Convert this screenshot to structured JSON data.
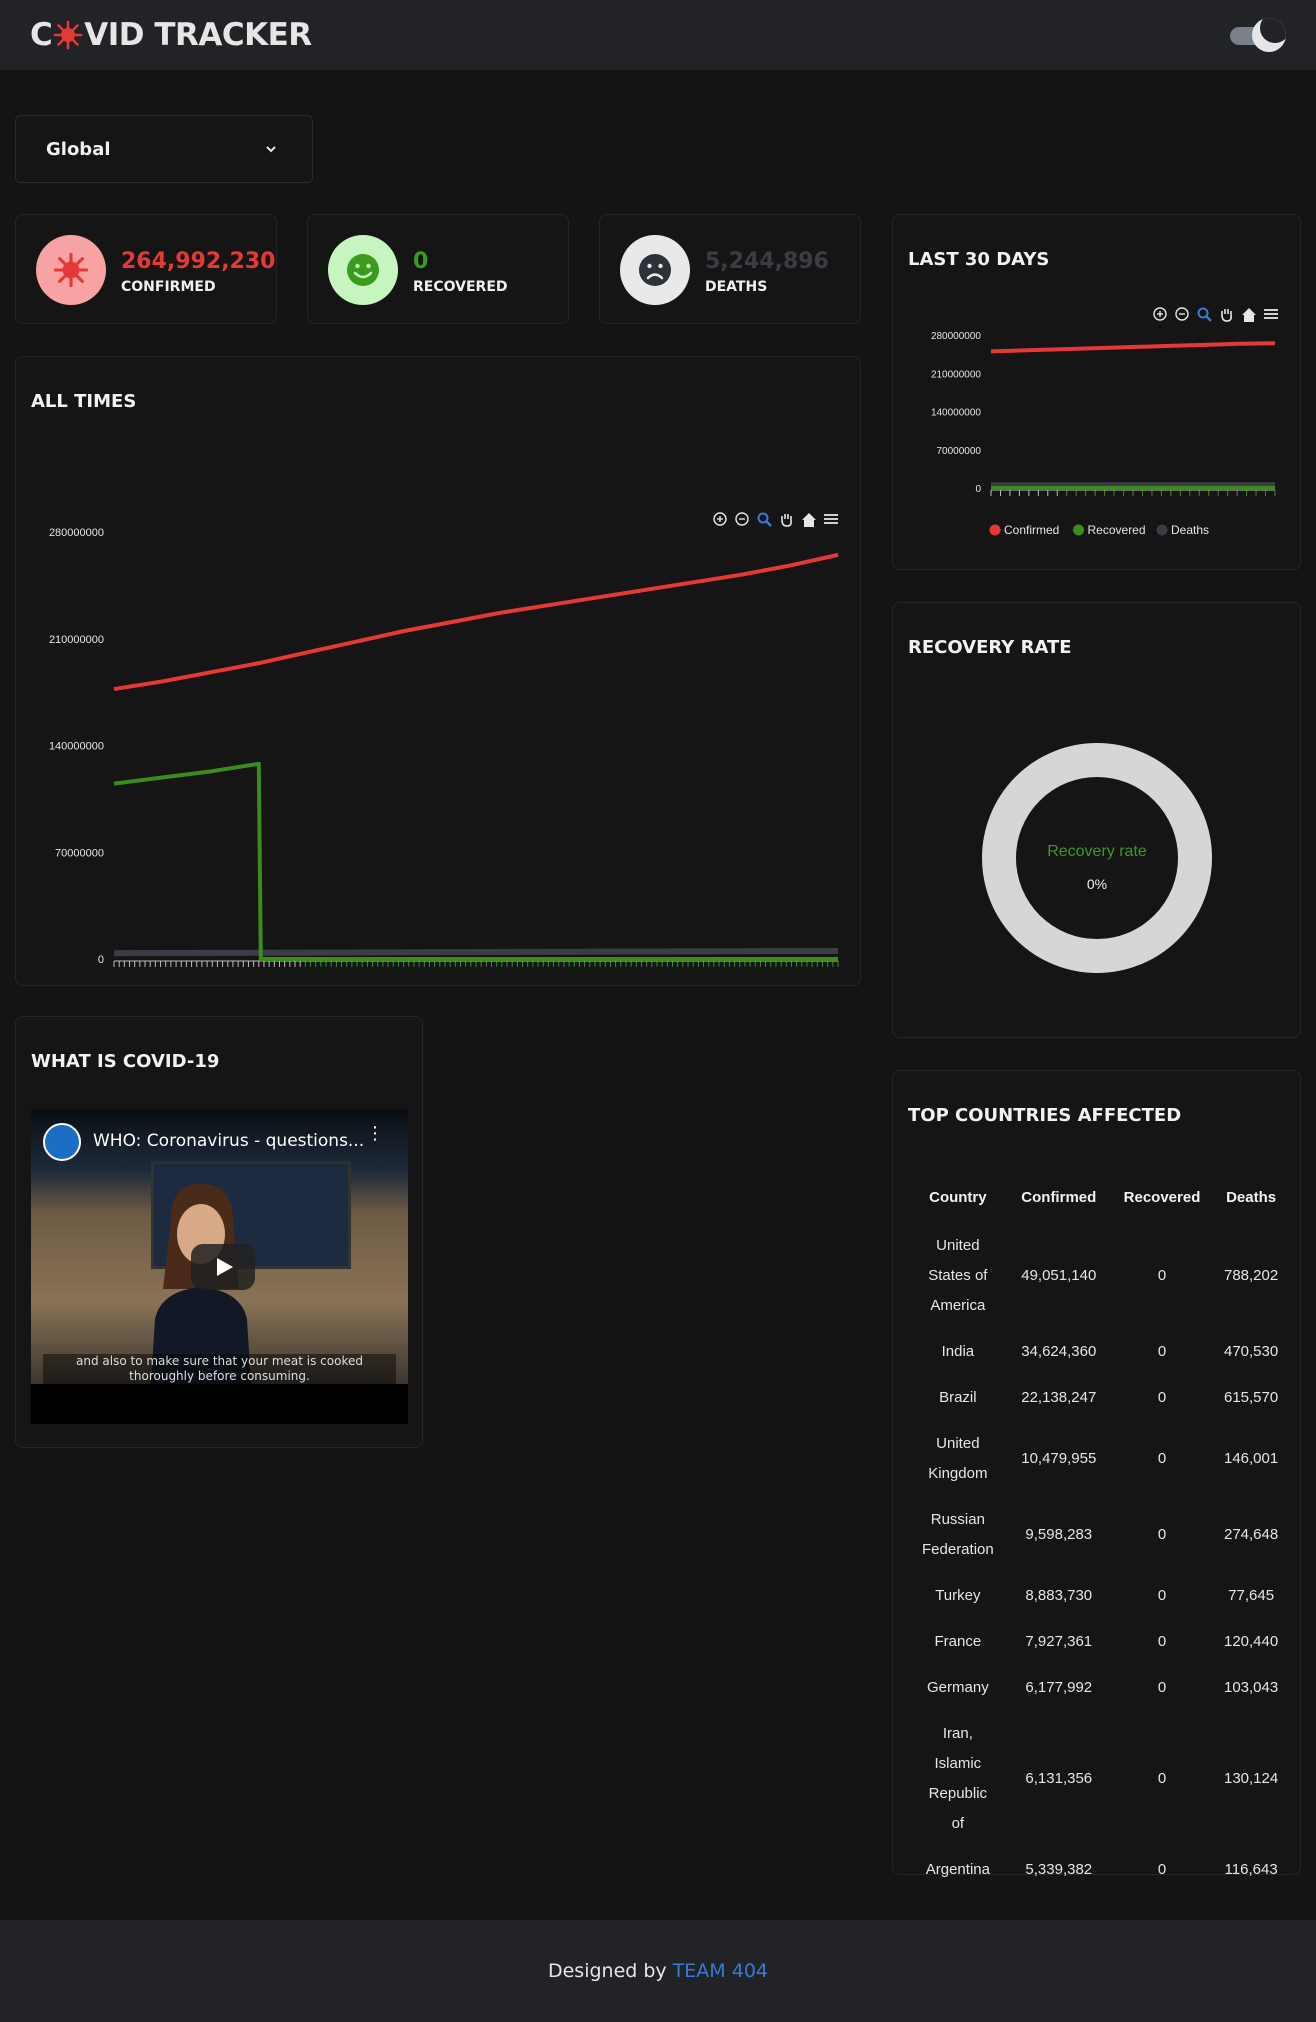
{
  "header": {
    "logo_prefix": "C",
    "logo_suffix": "VID TRACKER",
    "logo_icon": "virus-icon",
    "theme_toggle_icon": "moon-icon"
  },
  "region_select": {
    "value": "Global"
  },
  "stats": [
    {
      "value": "264,992,230",
      "label": "CONFIRMED",
      "color": "#e53935",
      "icon": "virus-icon"
    },
    {
      "value": "0",
      "label": "RECOVERED",
      "color": "#3c9a1c",
      "icon": "smile-icon"
    },
    {
      "value": "5,244,896",
      "label": "DEATHS",
      "color": "#3a3d44",
      "icon": "sad-icon"
    }
  ],
  "all_times": {
    "title": "ALL TIMES"
  },
  "last_30": {
    "title": "LAST 30 DAYS"
  },
  "recovery": {
    "title": "RECOVERY RATE",
    "label": "Recovery rate",
    "value": "0%"
  },
  "video": {
    "section_title": "WHAT IS COVID-19",
    "title": "WHO: Coronavirus - questions...",
    "caption_line1": "and also to make sure that your meat is cooked",
    "caption_line2": "thoroughly before consuming."
  },
  "top_countries": {
    "title": "TOP COUNTRIES AFFECTED",
    "columns": [
      "Country",
      "Confirmed",
      "Recovered",
      "Deaths"
    ],
    "rows": [
      {
        "country": "United States of America",
        "confirmed": "49,051,140",
        "recovered": "0",
        "deaths": "788,202"
      },
      {
        "country": "India",
        "confirmed": "34,624,360",
        "recovered": "0",
        "deaths": "470,530"
      },
      {
        "country": "Brazil",
        "confirmed": "22,138,247",
        "recovered": "0",
        "deaths": "615,570"
      },
      {
        "country": "United Kingdom",
        "confirmed": "10,479,955",
        "recovered": "0",
        "deaths": "146,001"
      },
      {
        "country": "Russian Federation",
        "confirmed": "9,598,283",
        "recovered": "0",
        "deaths": "274,648"
      },
      {
        "country": "Turkey",
        "confirmed": "8,883,730",
        "recovered": "0",
        "deaths": "77,645"
      },
      {
        "country": "France",
        "confirmed": "7,927,361",
        "recovered": "0",
        "deaths": "120,440"
      },
      {
        "country": "Germany",
        "confirmed": "6,177,992",
        "recovered": "0",
        "deaths": "103,043"
      },
      {
        "country": "Iran, Islamic Republic of",
        "confirmed": "6,131,356",
        "recovered": "0",
        "deaths": "130,124"
      },
      {
        "country": "Argentina",
        "confirmed": "5,339,382",
        "recovered": "0",
        "deaths": "116,643"
      }
    ]
  },
  "footer": {
    "prefix": "Designed by",
    "team": "TEAM 404"
  },
  "chart_toolbar_icons": [
    "zoom-in-icon",
    "zoom-out-icon",
    "zoom-icon",
    "pan-icon",
    "home-icon",
    "menu-icon"
  ],
  "chart_data": [
    {
      "type": "line",
      "ylim": [
        0,
        280000000
      ],
      "yticks": [
        "280000000",
        "210000000",
        "140000000",
        "70000000",
        "0"
      ],
      "legend": "bottom",
      "series": [
        {
          "name": "Confirmed",
          "color": "#e53935",
          "values": [
            177000000,
            182000000,
            188000000,
            194000000,
            201000000,
            208000000,
            215000000,
            221000000,
            227000000,
            232000000,
            237000000,
            242000000,
            247000000,
            252000000,
            258000000,
            265000000
          ]
        },
        {
          "name": "Recovered",
          "color": "#3c8c1c",
          "values": [
            115000000,
            119000000,
            123000000,
            128000000,
            0,
            0,
            0,
            0,
            0,
            0,
            0,
            0,
            0,
            0,
            0,
            0
          ]
        },
        {
          "name": "Deaths",
          "color": "#3a3d44",
          "values": [
            3800000,
            3900000,
            4000000,
            4100000,
            4200000,
            4300000,
            4400000,
            4500000,
            4600000,
            4700000,
            4800000,
            4900000,
            5000000,
            5100000,
            5200000,
            5244896
          ]
        }
      ]
    },
    {
      "type": "line",
      "ylim": [
        0,
        280000000
      ],
      "yticks": [
        "280000000",
        "210000000",
        "140000000",
        "70000000",
        "0"
      ],
      "legend": "bottom",
      "series": [
        {
          "name": "Confirmed",
          "color": "#e53935",
          "values": [
            250000000,
            252000000,
            254000000,
            256000000,
            258000000,
            260000000,
            262000000,
            264000000,
            265000000
          ]
        },
        {
          "name": "Recovered",
          "color": "#3c8c1c",
          "values": [
            0,
            0,
            0,
            0,
            0,
            0,
            0,
            0,
            0
          ]
        },
        {
          "name": "Deaths",
          "color": "#3a3d44",
          "values": [
            5050000,
            5080000,
            5110000,
            5140000,
            5170000,
            5200000,
            5220000,
            5235000,
            5244896
          ]
        }
      ]
    },
    {
      "type": "pie",
      "series": [
        {
          "name": "Recovery rate",
          "values": [
            0
          ]
        }
      ]
    }
  ]
}
